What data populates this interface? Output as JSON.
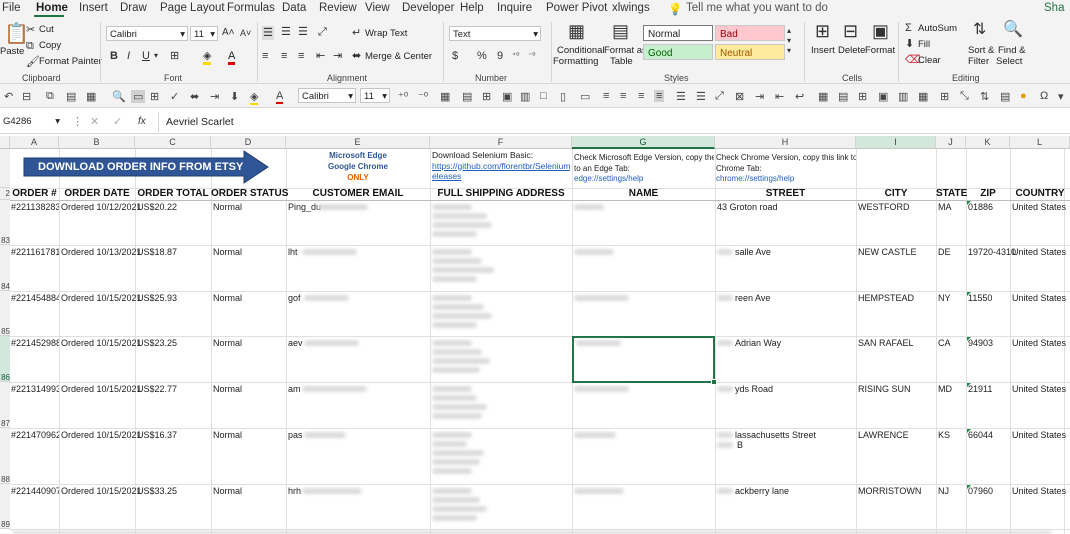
{
  "menu": {
    "file": "File",
    "home": "Home",
    "insert": "Insert",
    "draw": "Draw",
    "page_layout": "Page Layout",
    "formulas": "Formulas",
    "data": "Data",
    "review": "Review",
    "view": "View",
    "developer": "Developer",
    "help": "Help",
    "inquire": "Inquire",
    "power_pivot": "Power Pivot",
    "xlwings": "xlwings",
    "tell_me": "Tell me what you want to do",
    "share": "Sha"
  },
  "ribbon": {
    "clipboard": {
      "paste": "Paste",
      "cut": "Cut",
      "copy": "Copy",
      "format_painter": "Format Painter",
      "label": "Clipboard"
    },
    "font": {
      "name": "Calibri",
      "size": "11",
      "label": "Font"
    },
    "alignment": {
      "wrap_text": "Wrap Text",
      "merge_center": "Merge & Center",
      "label": "Alignment"
    },
    "number": {
      "format": "Text",
      "dollar": "$",
      "percent": "%",
      "comma": "9",
      "label": "Number"
    },
    "styles": {
      "conditional": "Conditional",
      "formatting": "Formatting",
      "format_as": "Format as",
      "table": "Table",
      "normal": "Normal",
      "bad": "Bad",
      "good": "Good",
      "neutral": "Neutral",
      "label": "Styles"
    },
    "cells": {
      "insert": "Insert",
      "delete": "Delete",
      "format": "Format",
      "label": "Cells"
    },
    "editing": {
      "autosum": "AutoSum",
      "fill": "Fill",
      "clear": "Clear",
      "sort_filter": "Sort &",
      "filter": "Filter",
      "find_select": "Find &",
      "select": "Select",
      "label": "Editing"
    }
  },
  "qat": {
    "font": "Calibri",
    "size": "11"
  },
  "formula_bar": {
    "name_box": "G4286",
    "fx": "fx",
    "value": "Aevriel Scarlet"
  },
  "columns": [
    "A",
    "B",
    "C",
    "D",
    "E",
    "F",
    "G",
    "H",
    "I",
    "J",
    "K",
    "L"
  ],
  "banner": {
    "download_button": "DOWNLOAD ORDER INFO FROM ETSY",
    "edge_line1": "Microsoft Edge",
    "edge_line2": "Google Chrome",
    "edge_line3": "ONLY",
    "selenium_title": "Download Selenium Basic:",
    "selenium_link1": "https://github.com/florentbr/SeleniumBasic/r",
    "selenium_link2": "eleases",
    "edge_check1": "Check Microsoft Edge Version, copy the link",
    "edge_check2": "to an Edge Tab:",
    "edge_check3": "edge://settings/help",
    "chrome_check1": "Check Chrome Version, copy this link to a",
    "chrome_check2": "Chrome Tab:",
    "chrome_check3": "chrome://settings/help"
  },
  "headers": [
    "ORDER #",
    "ORDER DATE",
    "ORDER TOTAL",
    "ORDER STATUS",
    "CUSTOMER EMAIL",
    "FULL SHIPPING ADDRESS",
    "NAME",
    "STREET",
    "CITY",
    "STATE",
    "ZIP",
    "COUNTRY"
  ],
  "row_numbers": [
    "2",
    "83",
    "84",
    "85",
    "86",
    "87",
    "88",
    "89"
  ],
  "rows": [
    {
      "order": "#2211382833",
      "date": "Ordered 10/12/2021",
      "total": "US$20.22",
      "status": "Normal",
      "email": "Ping_du",
      "street": "43 Groton road",
      "street2": "",
      "city": "WESTFORD",
      "state": "MA",
      "zip": "01886",
      "country": "United States"
    },
    {
      "order": "#2211617815",
      "date": "Ordered 10/13/2021",
      "total": "US$18.87",
      "status": "Normal",
      "email": "lht",
      "street": "salle Ave",
      "street2": "",
      "city": "NEW CASTLE",
      "state": "DE",
      "zip": "19720-4310",
      "country": "United States"
    },
    {
      "order": "#2214548845",
      "date": "Ordered 10/15/2021",
      "total": "US$25.93",
      "status": "Normal",
      "email": "gof",
      "street": "reen Ave",
      "street2": "",
      "city": "HEMPSTEAD",
      "state": "NY",
      "zip": "11550",
      "country": "United States"
    },
    {
      "order": "#2214529889",
      "date": "Ordered 10/15/2021",
      "total": "US$23.25",
      "status": "Normal",
      "email": "aev",
      "street": "Adrian Way",
      "street2": "",
      "city": "SAN RAFAEL",
      "state": "CA",
      "zip": "94903",
      "country": "United States"
    },
    {
      "order": "#2213149932",
      "date": "Ordered 10/15/2021",
      "total": "US$22.77",
      "status": "Normal",
      "email": "am",
      "street": "yds Road",
      "street2": "",
      "city": "RISING SUN",
      "state": "MD",
      "zip": "21911",
      "country": "United States"
    },
    {
      "order": "#2214709623",
      "date": "Ordered 10/15/2021",
      "total": "US$16.37",
      "status": "Normal",
      "email": "pas",
      "street": "lassachusetts Street",
      "street2": "B",
      "city": "LAWRENCE",
      "state": "KS",
      "zip": "66044",
      "country": "United States"
    },
    {
      "order": "#2214409075",
      "date": "Ordered 10/15/2021",
      "total": "US$33.25",
      "status": "Normal",
      "email": "hrh",
      "street": "ackberry lane",
      "street2": "",
      "city": "MORRISTOWN",
      "state": "NJ",
      "zip": "07960",
      "country": "United States"
    }
  ],
  "colors": {
    "accent": "#217346",
    "banner_blue": "#2f5597",
    "link": "#1f5fbf",
    "bad_bg": "#ffc7ce",
    "good_bg": "#c6efce",
    "neutral_bg": "#ffeb9c"
  }
}
